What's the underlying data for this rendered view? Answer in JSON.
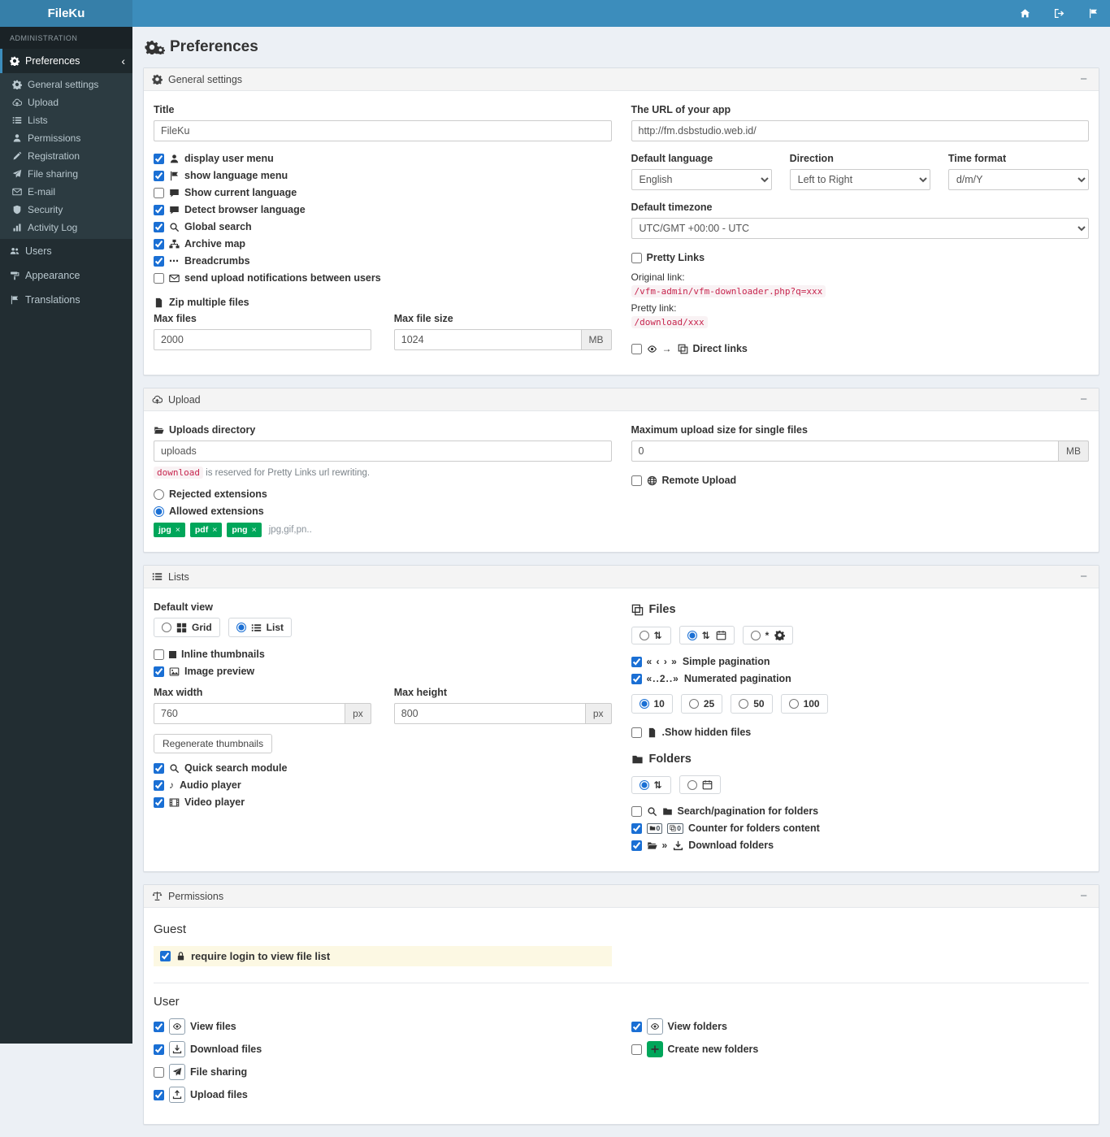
{
  "colors": {
    "topbar": "#3c8dbc",
    "logo_bg": "#367fa9",
    "sidebar": "#222d32",
    "submenu": "#2c3b41",
    "accent_green": "#00a65a",
    "code_red": "#c7254e",
    "highlight_yellow": "#fcf8e3",
    "checkbox_blue": "#1a6fd4"
  },
  "icons": {
    "minus": "−",
    "chevron_left": "‹",
    "sort": "⇅",
    "asterisk": "*",
    "pag_simple": "« ‹ › »",
    "pag_numerated": "«..2..»",
    "ellipsis": "⋯",
    "arrow_right": "→",
    "music": "♪",
    "close": "×",
    "zero": "0",
    "angle_right": "»"
  },
  "topbar": {
    "brand": "FileKu"
  },
  "sidebar": {
    "section": "ADMINISTRATION",
    "preferences": "Preferences",
    "submenu": [
      {
        "label": "General settings"
      },
      {
        "label": "Upload"
      },
      {
        "label": "Lists"
      },
      {
        "label": "Permissions"
      },
      {
        "label": "Registration"
      },
      {
        "label": "File sharing"
      },
      {
        "label": "E-mail"
      },
      {
        "label": "Security"
      },
      {
        "label": "Activity Log"
      }
    ],
    "items": [
      {
        "label": "Users"
      },
      {
        "label": "Appearance"
      },
      {
        "label": "Translations"
      }
    ]
  },
  "page": {
    "title": "Preferences"
  },
  "general": {
    "header": "General settings",
    "title_label": "Title",
    "title_value": "FileKu",
    "checks": [
      {
        "label": "display user menu",
        "checked": true
      },
      {
        "label": "show language menu",
        "checked": true
      },
      {
        "label": "Show current language",
        "checked": false
      },
      {
        "label": "Detect browser language",
        "checked": true
      },
      {
        "label": "Global search",
        "checked": true
      },
      {
        "label": "Archive map",
        "checked": true
      },
      {
        "label": "Breadcrumbs",
        "checked": true
      },
      {
        "label": "send upload notifications between users",
        "checked": false
      }
    ],
    "zip_label": "Zip multiple files",
    "max_files": {
      "label": "Max files",
      "value": "2000"
    },
    "max_filesize": {
      "label": "Max file size",
      "value": "1024",
      "addon": "MB"
    },
    "url": {
      "label": "The URL of your app",
      "value": "http://fm.dsbstudio.web.id/"
    },
    "language": {
      "label": "Default language",
      "value": "English"
    },
    "direction": {
      "label": "Direction",
      "value": "Left to Right"
    },
    "timeformat": {
      "label": "Time format",
      "value": "d/m/Y"
    },
    "timezone": {
      "label": "Default timezone",
      "value": "UTC/GMT +00:00 - UTC"
    },
    "pretty_links": {
      "label": "Pretty Links",
      "checked": false
    },
    "original_link_label": "Original link:",
    "original_link_code": "/vfm-admin/vfm-downloader.php?q=xxx",
    "pretty_link_label": "Pretty link:",
    "pretty_link_code": "/download/xxx",
    "direct_links": {
      "label": "Direct links",
      "checked": false
    }
  },
  "upload": {
    "header": "Upload",
    "dir_label": "Uploads directory",
    "dir_value": "uploads",
    "help_code": "download",
    "help_text": " is reserved for Pretty Links url rewriting.",
    "rejected": {
      "label": "Rejected extensions",
      "checked": false
    },
    "allowed": {
      "label": "Allowed extensions",
      "checked": true
    },
    "tags": [
      {
        "label": "jpg"
      },
      {
        "label": "pdf"
      },
      {
        "label": "png"
      }
    ],
    "tags_more": "jpg,gif,pn..",
    "max_single": {
      "label": "Maximum upload size for single files",
      "value": "0",
      "addon": "MB"
    },
    "remote": {
      "label": "Remote Upload",
      "checked": false
    }
  },
  "lists": {
    "header": "Lists",
    "default_view_label": "Default view",
    "view_grid": {
      "label": "Grid",
      "checked": false
    },
    "view_list": {
      "label": "List",
      "checked": true
    },
    "inline_thumbs": {
      "label": "Inline thumbnails",
      "checked": false
    },
    "image_preview": {
      "label": "Image preview",
      "checked": true
    },
    "max_width": {
      "label": "Max width",
      "value": "760",
      "addon": "px"
    },
    "max_height": {
      "label": "Max height",
      "value": "800",
      "addon": "px"
    },
    "regen_button": "Regenerate thumbnails",
    "quick_search": {
      "label": "Quick search module",
      "checked": true
    },
    "audio_player": {
      "label": "Audio player",
      "checked": true
    },
    "video_player": {
      "label": "Video player",
      "checked": true
    },
    "files_heading": "Files",
    "file_sort": [
      {
        "checked": false
      },
      {
        "checked": true
      },
      {
        "checked": false
      }
    ],
    "simple_pagination": {
      "label": "Simple pagination",
      "checked": true
    },
    "numerated_pagination": {
      "label": "Numerated pagination",
      "checked": true
    },
    "page_sizes": [
      {
        "label": "10",
        "checked": true
      },
      {
        "label": "25",
        "checked": false
      },
      {
        "label": "50",
        "checked": false
      },
      {
        "label": "100",
        "checked": false
      }
    ],
    "show_hidden": {
      "label": ".Show hidden files",
      "checked": false
    },
    "folders_heading": "Folders",
    "folder_sort": [
      {
        "checked": true
      },
      {
        "checked": false
      }
    ],
    "folder_search": {
      "label": "Search/pagination for folders",
      "checked": false
    },
    "folder_counter": {
      "label": "Counter for folders content",
      "checked": true
    },
    "download_folders": {
      "label": "Download folders",
      "checked": true
    }
  },
  "permissions": {
    "header": "Permissions",
    "guest_heading": "Guest",
    "require_login": {
      "label": "require login to view file list",
      "checked": true
    },
    "user_heading": "User",
    "user_perms": [
      {
        "label": "View files",
        "checked": true
      },
      {
        "label": "Download files",
        "checked": true
      },
      {
        "label": "File sharing",
        "checked": false
      },
      {
        "label": "Upload files",
        "checked": true
      }
    ],
    "folder_perms": [
      {
        "label": "View folders",
        "checked": true
      },
      {
        "label": "Create new folders",
        "checked": false
      }
    ]
  }
}
